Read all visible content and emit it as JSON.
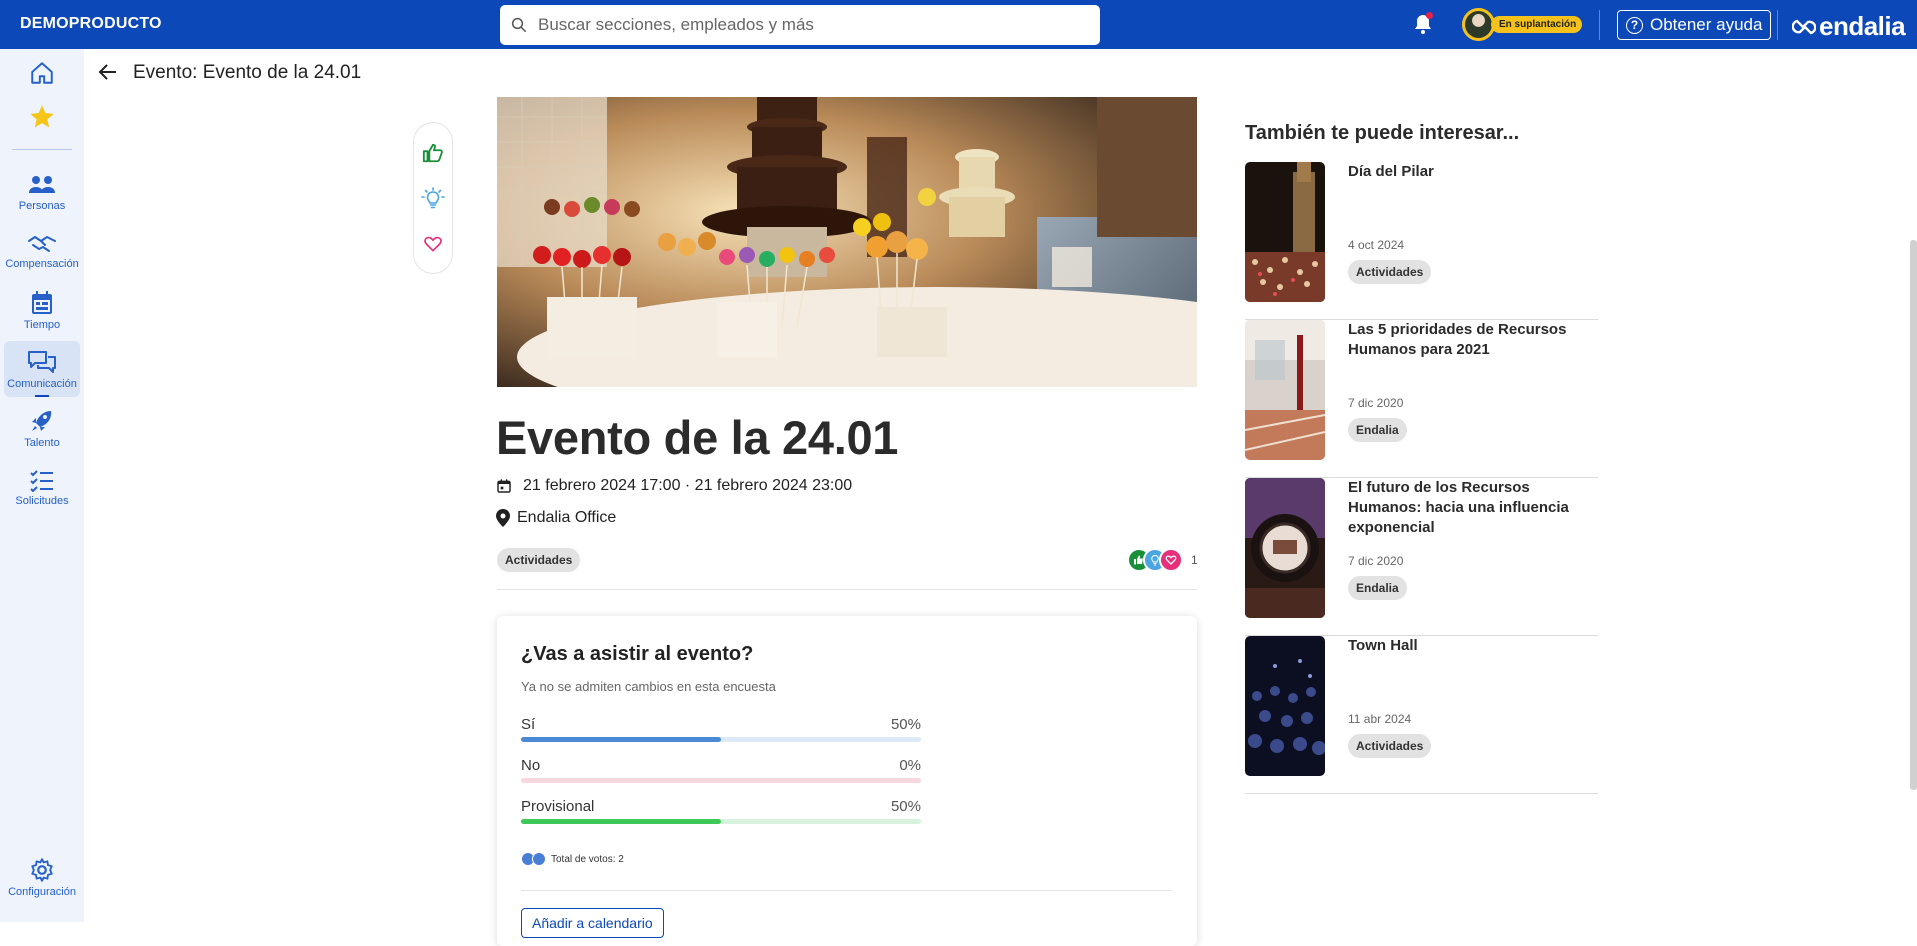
{
  "topbar": {
    "company": "DEMOPRODUCTO",
    "search_placeholder": "Buscar secciones, empleados y más",
    "impersonation_label": "En suplantación",
    "help_label": "Obtener ayuda",
    "logo_text": "endalia",
    "brand_color": "#0c48b7"
  },
  "sidebar": {
    "items": [
      {
        "label": "",
        "icon": "home-icon"
      },
      {
        "label": "",
        "icon": "star-icon"
      },
      {
        "label": "Personas",
        "icon": "people-icon"
      },
      {
        "label": "Compensación",
        "icon": "handshake-icon"
      },
      {
        "label": "Tiempo",
        "icon": "calendar-icon"
      },
      {
        "label": "Comunicación",
        "icon": "chat-icon"
      },
      {
        "label": "Talento",
        "icon": "rocket-icon"
      },
      {
        "label": "Solicitudes",
        "icon": "checklist-icon"
      },
      {
        "label": "Configuración",
        "icon": "gear-icon"
      }
    ],
    "active": "Comunicación"
  },
  "header": {
    "title": "Evento: Evento de la 24.01"
  },
  "event": {
    "title": "Evento de la 24.01",
    "dates": "21 febrero 2024 17:00 · 21 febrero 2024 23:00",
    "location": "Endalia Office",
    "category": "Actividades",
    "reactions_count": "1"
  },
  "survey": {
    "question": "¿Vas a asistir al evento?",
    "note": "Ya no se admiten cambios en esta encuesta",
    "options": [
      {
        "label": "Sí",
        "percent_text": "50%",
        "percent": 50,
        "color": "#4a8ad4",
        "track": "#dde9f7"
      },
      {
        "label": "No",
        "percent_text": "0%",
        "percent": 0,
        "color": "#e8839a",
        "track": "#f8d7df"
      },
      {
        "label": "Provisional",
        "percent_text": "50%",
        "percent": 50,
        "color": "#3ec95a",
        "track": "#d8f3dd"
      }
    ],
    "total_votes": "Total de votos: 2",
    "calendar_button": "Añadir a calendario"
  },
  "related": {
    "heading": "También te puede interesar...",
    "items": [
      {
        "title": "Día del Pilar",
        "date": "4 oct 2024",
        "category": "Actividades"
      },
      {
        "title": "Las 5 prioridades de Recursos Humanos para 2021",
        "date": "7 dic 2020",
        "category": "Endalia"
      },
      {
        "title": "El futuro de los Recursos Humanos: hacia una influencia exponencial",
        "date": "7 dic 2020",
        "category": "Endalia"
      },
      {
        "title": "Town Hall",
        "date": "11 abr 2024",
        "category": "Actividades"
      }
    ]
  }
}
